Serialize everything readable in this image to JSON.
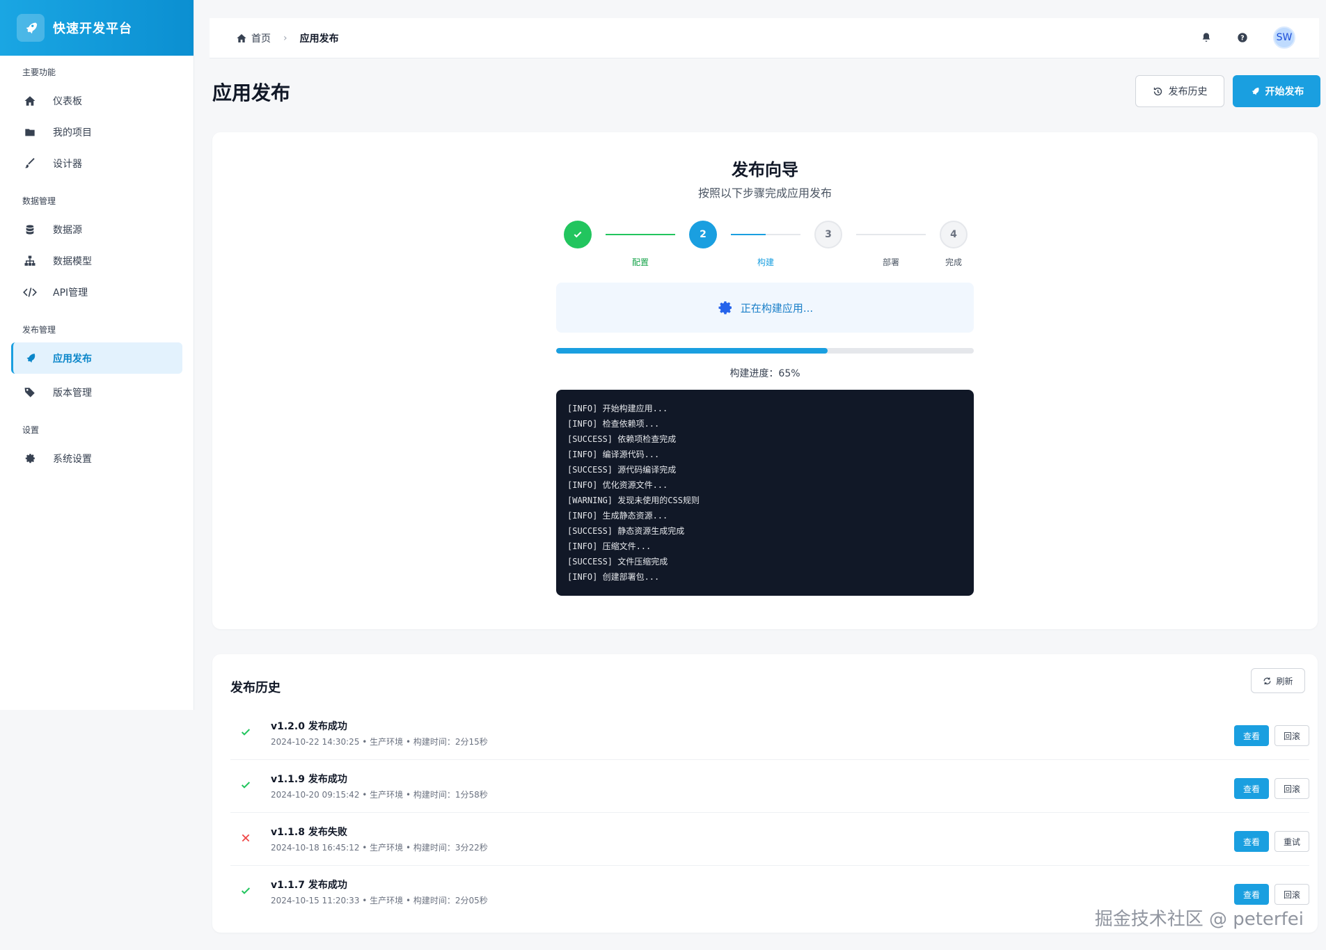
{
  "brand": {
    "title": "快速开发平台",
    "logo_icon": "rocket-icon"
  },
  "sidebar": {
    "sections": [
      {
        "title": "主要功能",
        "items": [
          {
            "label": "仪表板",
            "icon": "home-icon"
          },
          {
            "label": "我的项目",
            "icon": "folder-icon"
          },
          {
            "label": "设计器",
            "icon": "brush-icon"
          }
        ]
      },
      {
        "title": "数据管理",
        "items": [
          {
            "label": "数据源",
            "icon": "database-icon"
          },
          {
            "label": "数据模型",
            "icon": "sitemap-icon"
          },
          {
            "label": "API管理",
            "icon": "code-icon"
          }
        ]
      },
      {
        "title": "发布管理",
        "items": [
          {
            "label": "应用发布",
            "icon": "rocket-icon",
            "active": true
          },
          {
            "label": "版本管理",
            "icon": "tags-icon"
          }
        ]
      },
      {
        "title": "设置",
        "items": [
          {
            "label": "系统设置",
            "icon": "gear-icon"
          }
        ]
      }
    ]
  },
  "topbar": {
    "breadcrumb": {
      "home": "首页",
      "current": "应用发布"
    },
    "avatar": "SW"
  },
  "page": {
    "title": "应用发布",
    "history_button": "发布历史",
    "start_button": "开始发布"
  },
  "wizard": {
    "title": "发布向导",
    "subtitle": "按照以下步骤完成应用发布",
    "steps": [
      {
        "number": "1",
        "label": "配置",
        "state": "done"
      },
      {
        "number": "2",
        "label": "构建",
        "state": "current"
      },
      {
        "number": "3",
        "label": "部署",
        "state": "todo"
      },
      {
        "number": "4",
        "label": "完成",
        "state": "todo"
      }
    ],
    "status_text": "正在构建应用...",
    "progress": 65,
    "progress_text": "构建进度：65%",
    "logs": [
      "[INFO] 开始构建应用...",
      "[INFO] 检查依赖项...",
      "[SUCCESS] 依赖项检查完成",
      "[INFO] 编译源代码...",
      "[SUCCESS] 源代码编译完成",
      "[INFO] 优化资源文件...",
      "[WARNING] 发现未使用的CSS规则",
      "[INFO] 生成静态资源...",
      "[SUCCESS] 静态资源生成完成",
      "[INFO] 压缩文件...",
      "[SUCCESS] 文件压缩完成",
      "[INFO] 创建部署包..."
    ]
  },
  "history": {
    "title": "发布历史",
    "refresh_button": "刷新",
    "rows": [
      {
        "title": "v1.2.0 发布成功",
        "meta": "2024-10-22 14:30:25 • 生产环境 • 构建时间：2分15秒",
        "status": "success",
        "view": "查看",
        "action": "回滚"
      },
      {
        "title": "v1.1.9 发布成功",
        "meta": "2024-10-20 09:15:42 • 生产环境 • 构建时间：1分58秒",
        "status": "success",
        "view": "查看",
        "action": "回滚"
      },
      {
        "title": "v1.1.8 发布失败",
        "meta": "2024-10-18 16:45:12 • 生产环境 • 构建时间：3分22秒",
        "status": "failed",
        "view": "查看",
        "action": "重试"
      },
      {
        "title": "v1.1.7 发布成功",
        "meta": "2024-10-15 11:20:33 • 生产环境 • 构建时间：2分05秒",
        "status": "success",
        "view": "查看",
        "action": "回滚"
      }
    ]
  },
  "watermark": "掘金技术社区 @ peterfei",
  "colors": {
    "primary": "#1a9fe0",
    "success": "#22c55e",
    "danger": "#ef4444",
    "console_bg": "#111827"
  }
}
